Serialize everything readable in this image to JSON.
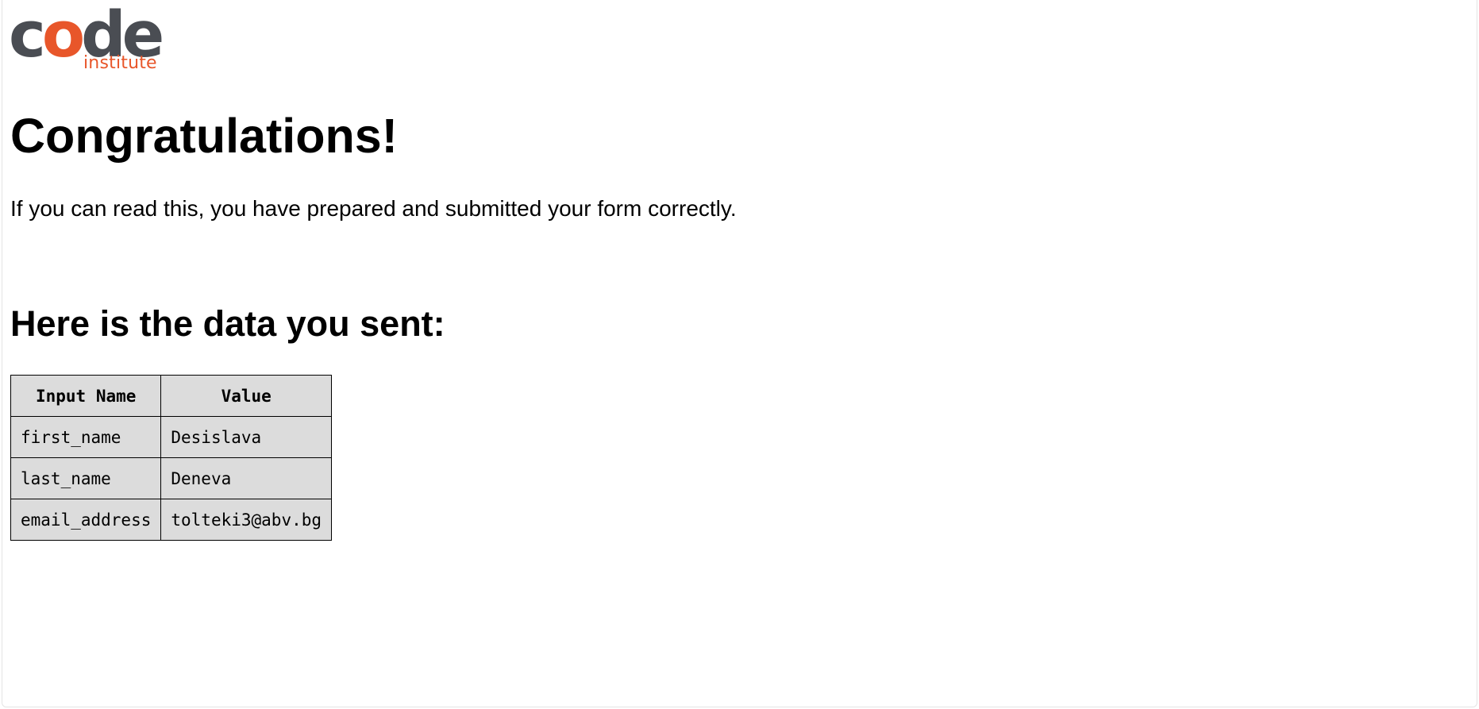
{
  "logo": {
    "word_c": "c",
    "word_o": "o",
    "word_de": "de",
    "sub": "institute",
    "colors": {
      "dark": "#4a4d53",
      "accent": "#e8562a"
    }
  },
  "heading": "Congratulations!",
  "intro": "If you can read this, you have prepared and submitted your form correctly.",
  "subheading": "Here is the data you sent:",
  "table": {
    "headers": [
      "Input Name",
      "Value"
    ],
    "rows": [
      [
        "first_name",
        "Desislava"
      ],
      [
        "last_name",
        "Deneva"
      ],
      [
        "email_address",
        "tolteki3@abv.bg"
      ]
    ]
  }
}
